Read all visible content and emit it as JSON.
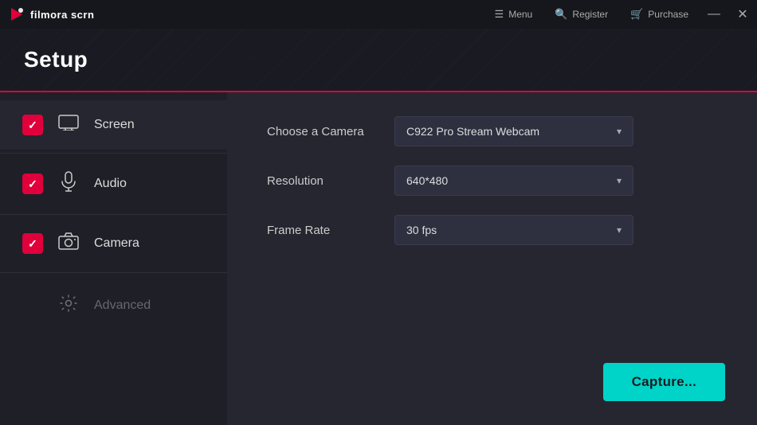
{
  "titlebar": {
    "logo_text": "filmora scrn",
    "menu_label": "Menu",
    "register_label": "Register",
    "purchase_label": "Purchase",
    "minimize_char": "—",
    "close_char": "✕"
  },
  "header": {
    "title": "Setup"
  },
  "sidebar": {
    "items": [
      {
        "id": "screen",
        "label": "Screen",
        "has_checkbox": true,
        "icon": "🖥"
      },
      {
        "id": "audio",
        "label": "Audio",
        "has_checkbox": true,
        "icon": "🎙"
      },
      {
        "id": "camera",
        "label": "Camera",
        "has_checkbox": true,
        "icon": "📷"
      },
      {
        "id": "advanced",
        "label": "Advanced",
        "has_checkbox": false,
        "icon": "⚙"
      }
    ]
  },
  "content": {
    "camera_label": "Choose a Camera",
    "camera_value": "C922 Pro Stream Webcam",
    "resolution_label": "Resolution",
    "resolution_value": "640*480",
    "framerate_label": "Frame Rate",
    "framerate_value": "30 fps",
    "capture_label": "Capture..."
  }
}
